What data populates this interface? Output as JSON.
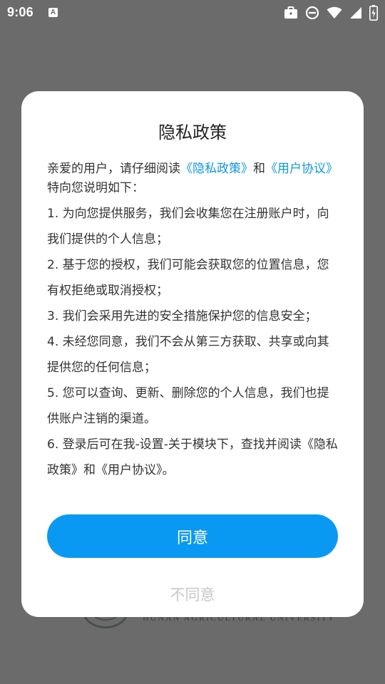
{
  "status_bar": {
    "time": "9:06",
    "a_badge": "A",
    "icons": [
      "briefcase-icon",
      "do-not-disturb-icon",
      "wifi-icon",
      "signal-icon",
      "battery-charging-icon"
    ],
    "color": "#ffffff"
  },
  "background": {
    "english_name": "HUNAN AGRICULTURAL UNIVERSITY"
  },
  "dialog": {
    "title": "隐私政策",
    "intro": {
      "prefix": "亲爱的用户，请仔细阅读",
      "link_privacy": "《隐私政策》",
      "middle": "和",
      "link_agreement": "《用户协议》",
      "suffix": "特向您说明如下："
    },
    "items": [
      "1. 为向您提供服务，我们会收集您在注册账户时，向我们提供的个人信息；",
      "2. 基于您的授权，我们可能会获取您的位置信息，您有权拒绝或取消授权；",
      "3. 我们会采用先进的安全措施保护您的信息安全；",
      "4. 未经您同意，我们不会从第三方获取、共享或向其提供您的任何信息；",
      "5. 您可以查询、更新、删除您的个人信息，我们也提供账户注销的渠道。",
      "6. 登录后可在我-设置-关于模块下，查找并阅读《隐私政策》和《用户协议》。"
    ],
    "agree_label": "同意",
    "disagree_label": "不同意"
  },
  "colors": {
    "overlay": "#6b6b6b",
    "link": "#1296db",
    "agree_button": "#0a99f2",
    "disagree_text": "#c7c7c7"
  }
}
